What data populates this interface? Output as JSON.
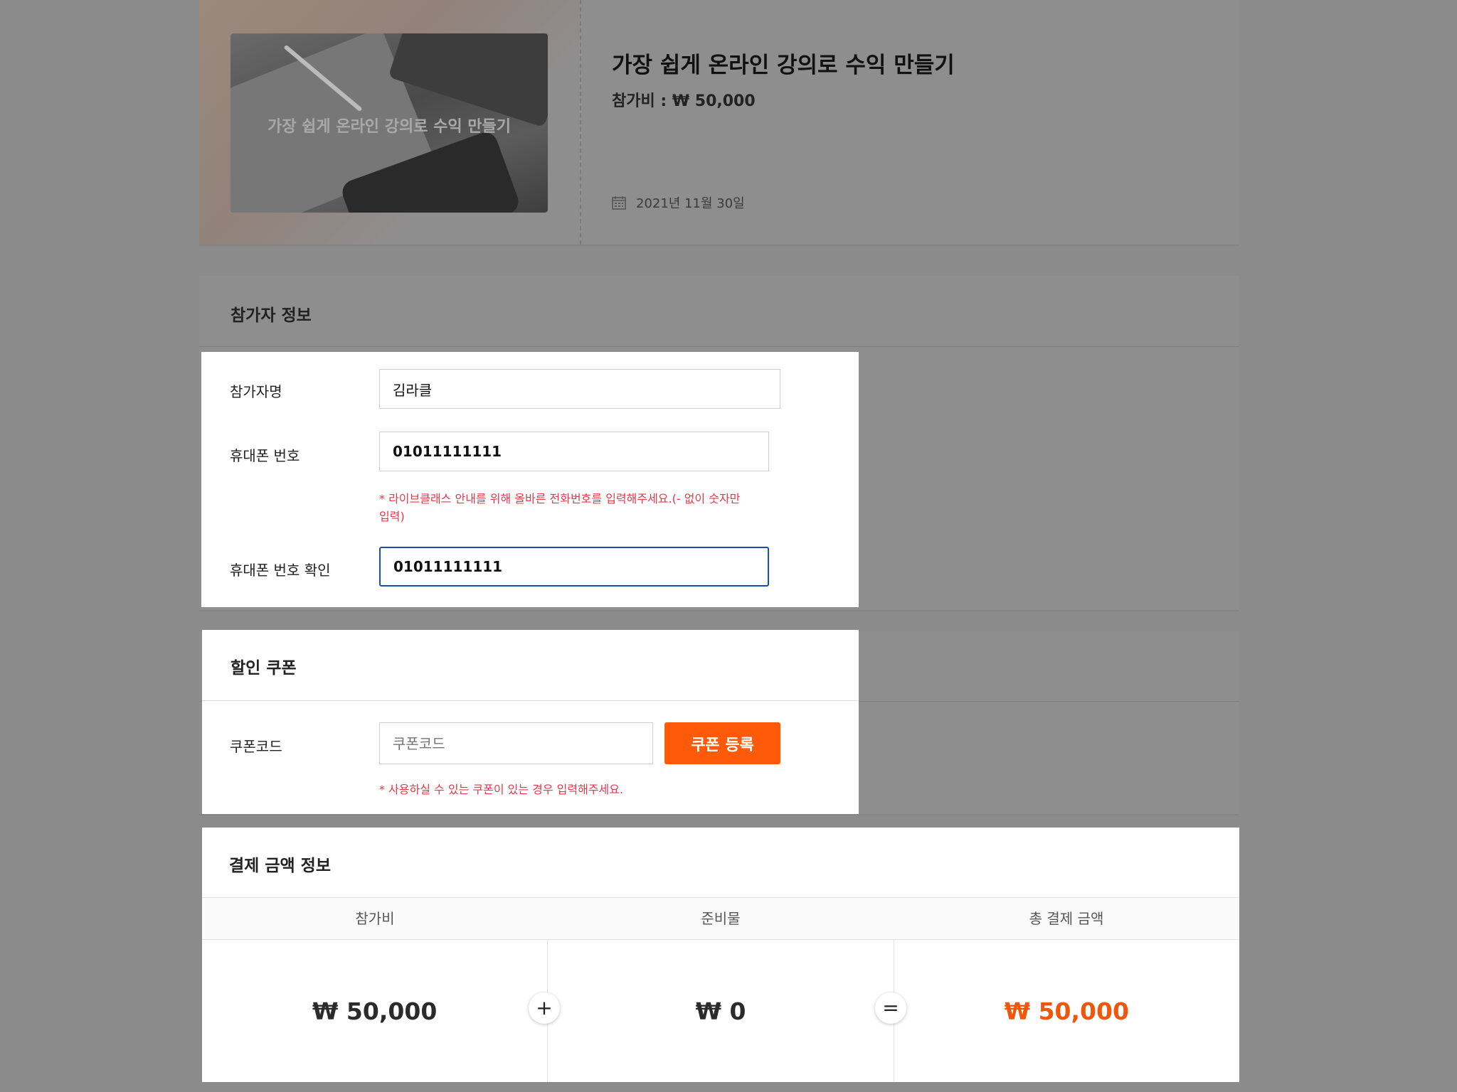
{
  "product": {
    "thumbnail_caption": "가장 쉽게 온라인 강의로 수익 만들기",
    "title": "가장 쉽게 온라인 강의로 수익 만들기",
    "price_label": "참가비 : ₩ 50,000",
    "date": "2021년 11월 30일",
    "date_icon": "calendar-icon"
  },
  "participant": {
    "section_title": "참가자 정보",
    "name_label": "참가자명",
    "name_value": "김라클",
    "phone_label": "휴대폰 번호",
    "phone_value": "01011111111",
    "phone_hint_line1": "* 라이브클래스 안내를 위해 올바른 전화번호를 입력해주세요.(- 없이 숫자만",
    "phone_hint_line2": "입력)",
    "phone_confirm_label": "휴대폰 번호 확인",
    "phone_confirm_value": "01011111111"
  },
  "coupon": {
    "section_title": "할인 쿠폰",
    "code_label": "쿠폰코드",
    "code_placeholder": "쿠폰코드",
    "register_button": "쿠폰 등록",
    "hint": "* 사용하실 수 있는 쿠폰이 있는 경우 입력해주세요."
  },
  "payment": {
    "section_title": "결제 금액 정보",
    "columns": [
      "참가비",
      "준비물",
      "총 결제 금액"
    ],
    "values": [
      "₩ 50,000",
      "₩ 0",
      "₩ 50,000"
    ],
    "plus_sign": "+",
    "equals_sign": "="
  },
  "colors": {
    "accent": "#ff5a0a",
    "hint_red": "#e23a4b",
    "focus_blue": "#1a4fa6",
    "overlay": "#8c8b8c"
  }
}
